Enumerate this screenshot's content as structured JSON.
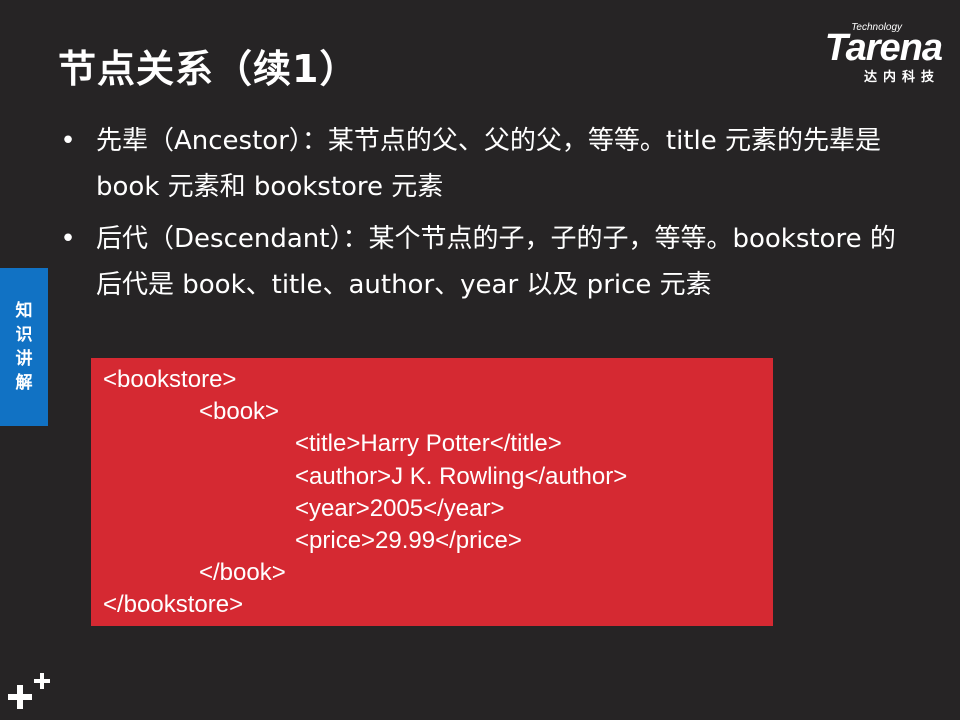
{
  "slide": {
    "title": "节点关系（续1）"
  },
  "logo": {
    "tech": "Technology",
    "brand": "Tarena",
    "cn": "达内科技"
  },
  "bullets": [
    {
      "marker": "•",
      "text": "先辈（Ancestor）：某节点的父、父的父，等等。title 元素的先辈是 book 元素和 bookstore 元素"
    },
    {
      "marker": "•",
      "text": "后代（Descendant）：某个节点的子，子的子，等等。bookstore 的后代是 book、title、author、year 以及 price 元素"
    }
  ],
  "side_tab": {
    "chars": [
      "知",
      "识",
      "讲",
      "解"
    ]
  },
  "code": {
    "lines": [
      {
        "indent": 0,
        "text": "<bookstore>"
      },
      {
        "indent": 1,
        "text": "<book>"
      },
      {
        "indent": 2,
        "text": "<title>Harry Potter</title>"
      },
      {
        "indent": 2,
        "text": "<author>J K. Rowling</author>"
      },
      {
        "indent": 2,
        "text": "<year>2005</year>"
      },
      {
        "indent": 2,
        "text": "<price>29.99</price>"
      },
      {
        "indent": 1,
        "text": "</book>"
      },
      {
        "indent": 0,
        "text": "</bookstore>"
      }
    ]
  },
  "colors": {
    "background": "#262425",
    "code_box": "#d52932",
    "side_tab": "#1172c4",
    "text": "#ffffff"
  },
  "icons": {
    "corner": "plus-icon"
  }
}
